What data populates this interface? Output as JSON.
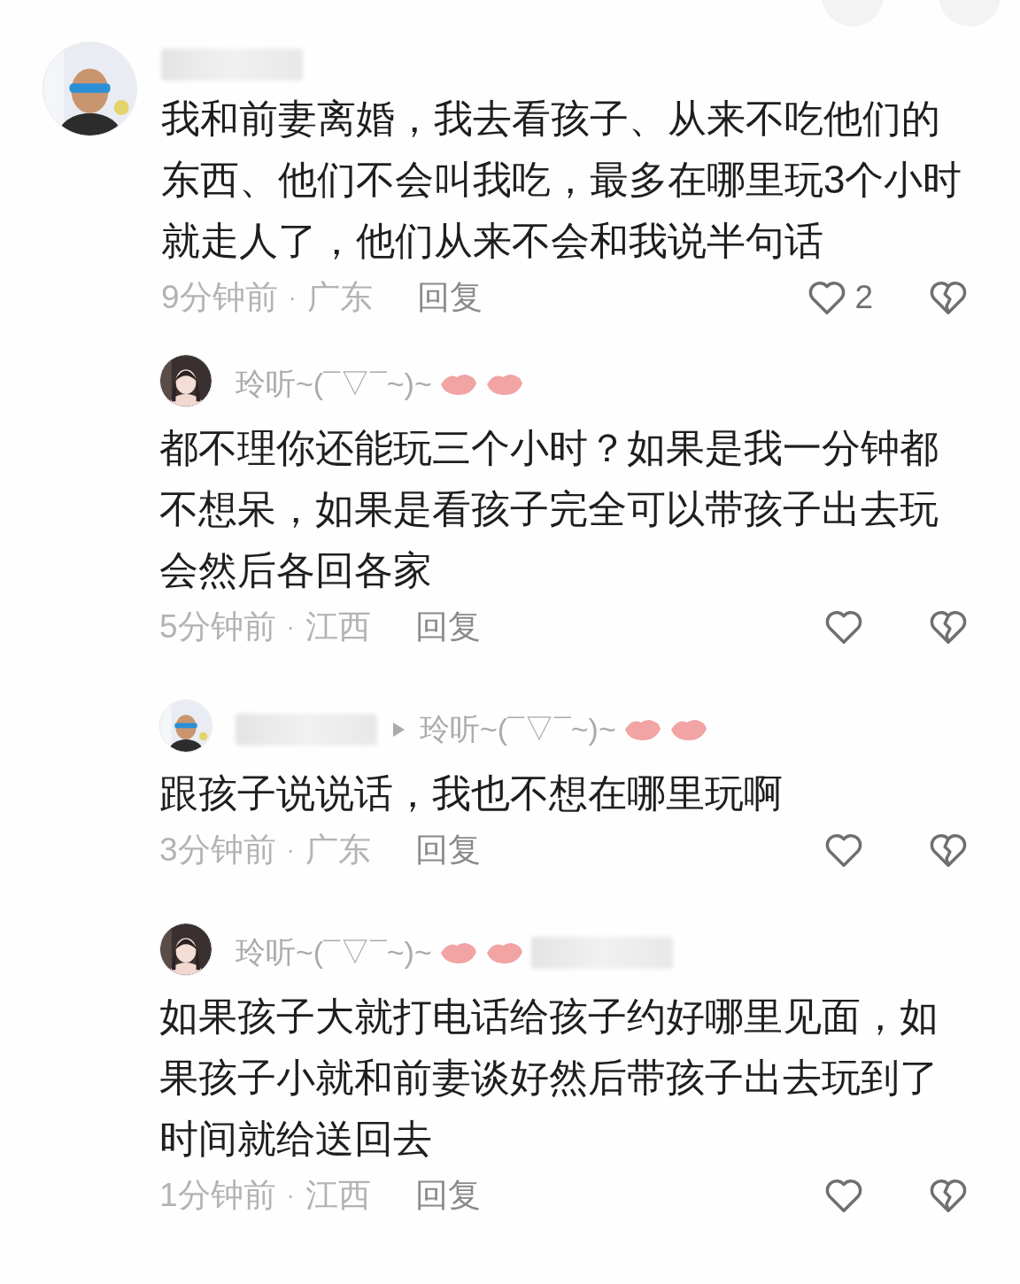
{
  "comments": [
    {
      "author": [
        {
          "kind": "blurred"
        }
      ],
      "text": "我和前妻离婚，我去看孩子、从来不吃他们的东西、他们不会叫我吃，最多在哪里玩3个小时就走人了，他们从来不会和我说半句话",
      "time": "9分钟前",
      "separator": "·",
      "region": "广东",
      "reply": "回复",
      "likes": "2",
      "replies": [
        {
          "author": [
            {
              "kind": "name",
              "text": "玲听~(¯▽¯~)~"
            },
            {
              "kind": "lips"
            },
            {
              "kind": "lips"
            }
          ],
          "text": "都不理你还能玩三个小时？如果是我一分钟都不想呆，如果是看孩子完全可以带孩子出去玩会然后各回各家",
          "time": "5分钟前",
          "separator": "·",
          "region": "江西",
          "reply": "回复"
        },
        {
          "author": [
            {
              "kind": "blurred"
            },
            {
              "kind": "arrow"
            },
            {
              "kind": "name",
              "text": "玲听~(¯▽¯~)~"
            },
            {
              "kind": "lips"
            },
            {
              "kind": "lips"
            }
          ],
          "text": "跟孩子说说话，我也不想在哪里玩啊",
          "time": "3分钟前",
          "separator": "·",
          "region": "广东",
          "reply": "回复"
        },
        {
          "author": [
            {
              "kind": "name",
              "text": "玲听~(¯▽¯~)~"
            },
            {
              "kind": "lips"
            },
            {
              "kind": "lips"
            },
            {
              "kind": "blurred"
            }
          ],
          "text": "如果孩子大就打电话给孩子约好哪里见面，如果孩子小就和前妻谈好然后带孩子出去玩到了时间就给送回去",
          "time": "1分钟前",
          "separator": "·",
          "region": "江西",
          "reply": "回复"
        }
      ]
    }
  ]
}
